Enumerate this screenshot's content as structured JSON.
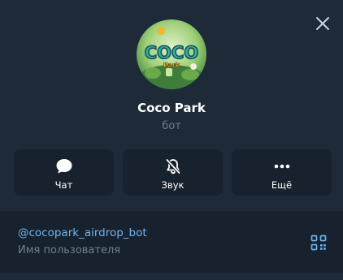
{
  "profile": {
    "name": "Coco Park",
    "subtitle": "бот",
    "avatar_logo_text": "COCO",
    "avatar_logo_subtext": "Park"
  },
  "actions": [
    {
      "label": "Чат",
      "icon": "chat-bubble-icon"
    },
    {
      "label": "Звук",
      "icon": "bell-muted-icon"
    },
    {
      "label": "Ещё",
      "icon": "more-dots-icon"
    }
  ],
  "info": {
    "username": "@cocopark_airdrop_bot",
    "username_caption": "Имя пользователя",
    "qr_icon": "qr-code-icon"
  },
  "colors": {
    "background": "#1e2a38",
    "card": "#18222e",
    "accent": "#6cb4ee",
    "muted_text": "#6d7f92"
  }
}
